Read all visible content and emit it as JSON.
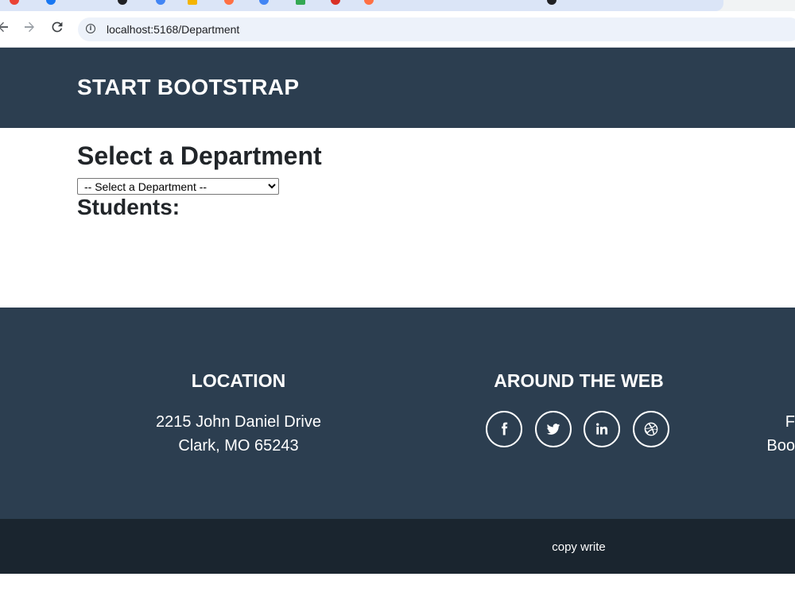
{
  "browser": {
    "url": "localhost:5168/Department",
    "back_icon": "arrow-left-icon",
    "forward_icon": "arrow-right-icon",
    "reload_icon": "reload-icon",
    "info_icon": "info-icon"
  },
  "header": {
    "brand": "START BOOTSTRAP"
  },
  "main": {
    "title": "Select a Department",
    "select": {
      "selected": "-- Select a Department --"
    },
    "students_heading": "Students:"
  },
  "footer": {
    "location": {
      "heading": "LOCATION",
      "address_line1": "2215 John Daniel Drive",
      "address_line2": "Clark, MO 65243"
    },
    "web": {
      "heading": "AROUND THE WEB",
      "icons": [
        "facebook-icon",
        "twitter-icon",
        "linkedin-icon",
        "dribbble-icon"
      ]
    },
    "about_partial": {
      "line1": "F",
      "line2": "Boo"
    },
    "copyright": "copy write"
  },
  "colors": {
    "primary_dark": "#2c3e50",
    "footer_bottom": "#1a252f",
    "text_dark": "#212529"
  }
}
